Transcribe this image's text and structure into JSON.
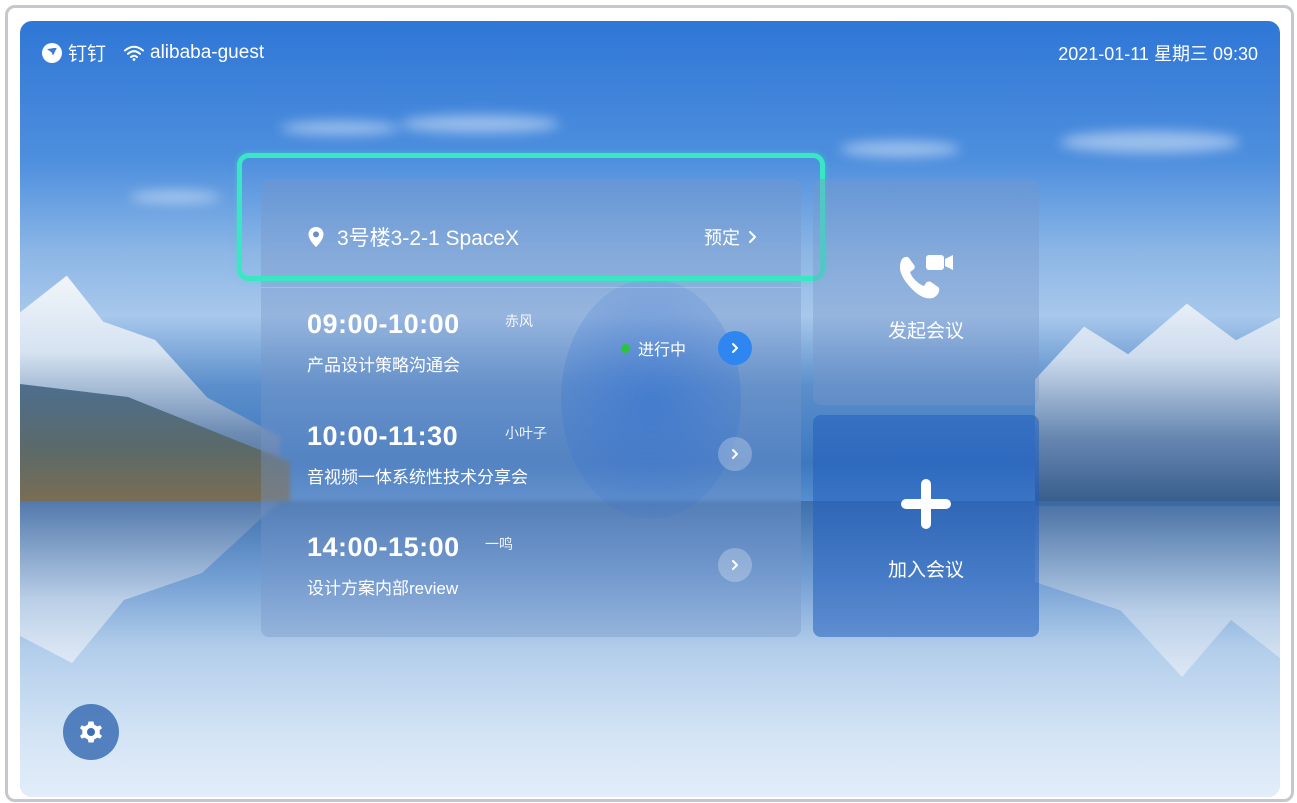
{
  "status_bar": {
    "brand": "钉钉",
    "network": "alibaba-guest",
    "datetime": "2021-01-11 星期三 09:30"
  },
  "room": {
    "location": "3号楼3-2-1 SpaceX",
    "reserve_label": "预定"
  },
  "meetings": [
    {
      "time": "09:00-10:00",
      "host": "赤风",
      "title": "产品设计策略沟通会",
      "status": "进行中"
    },
    {
      "time": "10:00-11:30",
      "host": "小叶子",
      "title": "音视频一体系统性技术分享会",
      "status": ""
    },
    {
      "time": "14:00-15:00",
      "host": "一鸣",
      "title": "设计方案内部review",
      "status": ""
    }
  ],
  "actions": {
    "start_meeting": "发起会议",
    "join_meeting": "加入会议"
  },
  "colors": {
    "highlight": "#3ae7c5",
    "accent": "#2f86f0",
    "status_live": "#29c53a"
  },
  "icons": {
    "brand": "dingtalk-logo-icon",
    "network": "wifi-icon",
    "location": "location-pin-icon",
    "start": "video-call-icon",
    "join": "plus-icon",
    "settings": "gear-icon"
  }
}
